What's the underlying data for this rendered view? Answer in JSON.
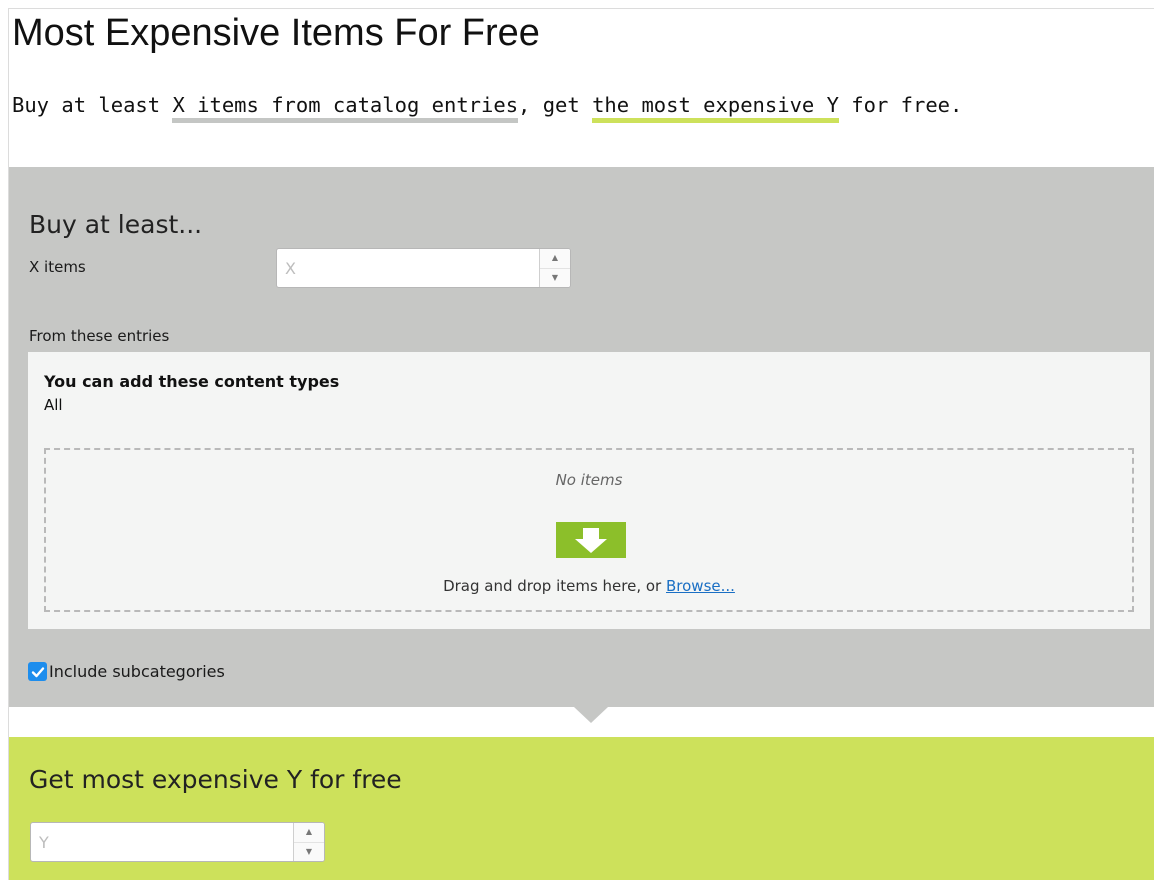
{
  "title": "Most Expensive Items For Free",
  "description": {
    "prefix": "Buy at least ",
    "condition": "X items from catalog entries",
    "middle": ", get ",
    "reward": "the most expensive Y",
    "suffix": " for free."
  },
  "buy_section": {
    "heading": "Buy at least...",
    "quantity_label": "X items",
    "quantity_placeholder": "X",
    "entries_label": "From these entries",
    "content_types_title": "You can add these content types",
    "content_types_value": "All",
    "empty_text": "No items",
    "drop_text": "Drag and drop items here, or ",
    "browse_link": "Browse...",
    "include_subcategories_label": "Include subcategories",
    "include_subcategories_checked": true
  },
  "reward_section": {
    "heading": "Get most expensive Y for free",
    "quantity_placeholder": "Y"
  },
  "icons": {
    "spinner_up": "▲",
    "spinner_down": "▼",
    "drop_icon": "arrow-down-icon",
    "checkbox_icon": "checkmark-icon"
  },
  "colors": {
    "condition_panel": "#c6c7c5",
    "reward_panel": "#cde15b",
    "drop_icon": "#8cbf2a",
    "checkbox": "#1d8ded",
    "link": "#1a6fc4"
  }
}
